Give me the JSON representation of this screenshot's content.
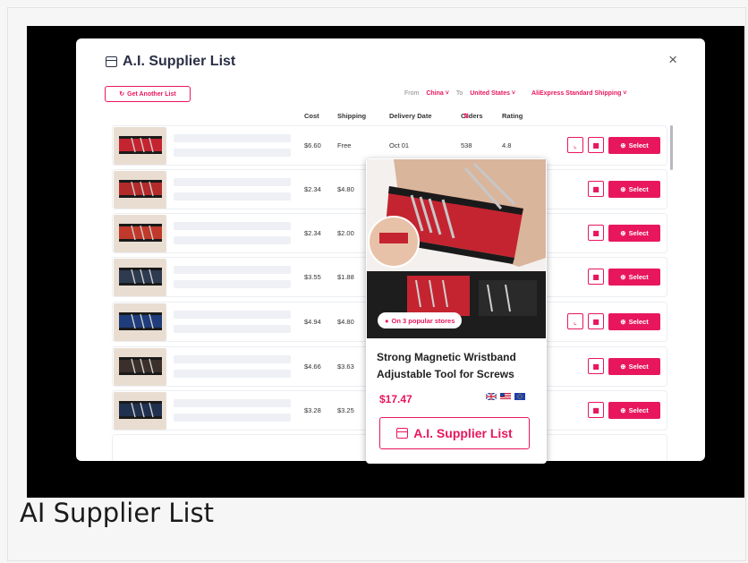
{
  "caption": "AI Supplier List",
  "modal": {
    "title": "A.I. Supplier List",
    "close": "×",
    "get_another": "Get Another List",
    "filters": {
      "from_label": "From",
      "from_value": "China",
      "to_label": "To",
      "to_value": "United States",
      "shipping": "AliExpress Standard Shipping"
    },
    "columns": [
      "Cost",
      "Shipping",
      "Delivery Date",
      "Orders",
      "Rating"
    ],
    "rows": [
      {
        "cost": "$6.60",
        "shipping": "Free",
        "delivery": "Oct 01",
        "orders": "538",
        "rating": "4.8"
      },
      {
        "cost": "$2.34",
        "shipping": "$4.80",
        "delivery": "",
        "orders": "",
        "rating": ""
      },
      {
        "cost": "$2.34",
        "shipping": "$2.00",
        "delivery": "",
        "orders": "",
        "rating": ""
      },
      {
        "cost": "$3.55",
        "shipping": "$1.88",
        "delivery": "",
        "orders": "",
        "rating": ""
      },
      {
        "cost": "$4.94",
        "shipping": "$4.80",
        "delivery": "",
        "orders": "",
        "rating": ""
      },
      {
        "cost": "$4.66",
        "shipping": "$3.63",
        "delivery": "",
        "orders": "",
        "rating": ""
      },
      {
        "cost": "$3.28",
        "shipping": "$3.25",
        "delivery": "",
        "orders": "",
        "rating": ""
      }
    ],
    "select_label": "Select"
  },
  "card": {
    "badge": "On 3 popular stores",
    "name": "Strong Magnetic Wristband Adjustable Tool for Screws",
    "price": "$17.47",
    "button": "A.I. Supplier List"
  },
  "colors": {
    "accent": "#e8175d",
    "title": "#2a2f45"
  }
}
